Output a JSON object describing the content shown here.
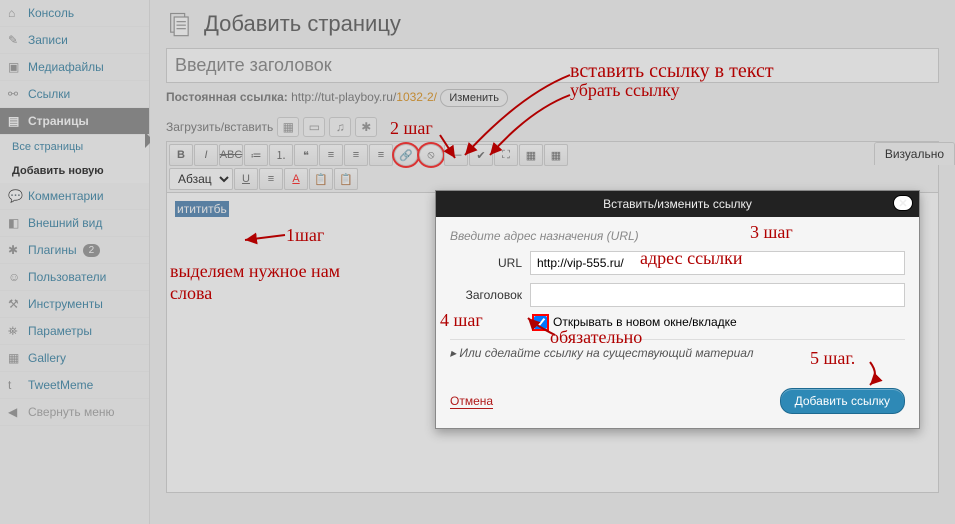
{
  "sidebar": {
    "items": [
      {
        "label": "Консоль",
        "icon": "home"
      },
      {
        "label": "Записи",
        "icon": "pin"
      },
      {
        "label": "Медиафайлы",
        "icon": "media"
      },
      {
        "label": "Ссылки",
        "icon": "link"
      },
      {
        "label": "Страницы",
        "icon": "page",
        "active": true
      },
      {
        "label": "Все страницы",
        "sub": true
      },
      {
        "label": "Добавить новую",
        "sub": true,
        "current": true
      },
      {
        "label": "Комментарии",
        "icon": "comment"
      },
      {
        "label": "Внешний вид",
        "icon": "appearance"
      },
      {
        "label": "Плагины",
        "icon": "plugin",
        "badge": "2"
      },
      {
        "label": "Пользователи",
        "icon": "users"
      },
      {
        "label": "Инструменты",
        "icon": "tools"
      },
      {
        "label": "Параметры",
        "icon": "settings"
      },
      {
        "label": "Gallery",
        "icon": "gallery"
      },
      {
        "label": "TweetMeme",
        "icon": "tweet"
      },
      {
        "label": "Свернуть меню",
        "icon": "collapse"
      }
    ]
  },
  "page": {
    "title": "Добавить страницу",
    "title_placeholder": "Введите заголовок",
    "permalink_label": "Постоянная ссылка:",
    "permalink_base": "http://tut-playboy.ru/",
    "permalink_slug": "1032-2/",
    "permalink_edit": "Изменить",
    "upload_label": "Загрузить/вставить",
    "tabs": {
      "visual": "Визуально"
    },
    "format_select": "Абзац",
    "selected_text": "итититбь"
  },
  "dialog": {
    "title": "Вставить/изменить ссылку",
    "hint": "Введите адрес назначения (URL)",
    "url_label": "URL",
    "url_value": "http://vip-555.ru/",
    "title_label": "Заголовок",
    "title_value": "",
    "newtab_label": "Открывать в новом окне/вкладке",
    "expand": "Или сделайте ссылку на существующий материал",
    "cancel": "Отмена",
    "submit": "Добавить ссылку"
  },
  "annotations": {
    "step1": "1шаг",
    "step1_desc": "выделяем нужное нам слова",
    "step2": "2 шаг",
    "step2_desc1": "вставить ссылку в текст",
    "step2_desc2": "убрать ссылку",
    "step3": "3 шаг",
    "step3_desc": "адрес ссылки",
    "step4": "4 шаг",
    "step4_desc": "обязательно",
    "step5": "5 шаг."
  }
}
